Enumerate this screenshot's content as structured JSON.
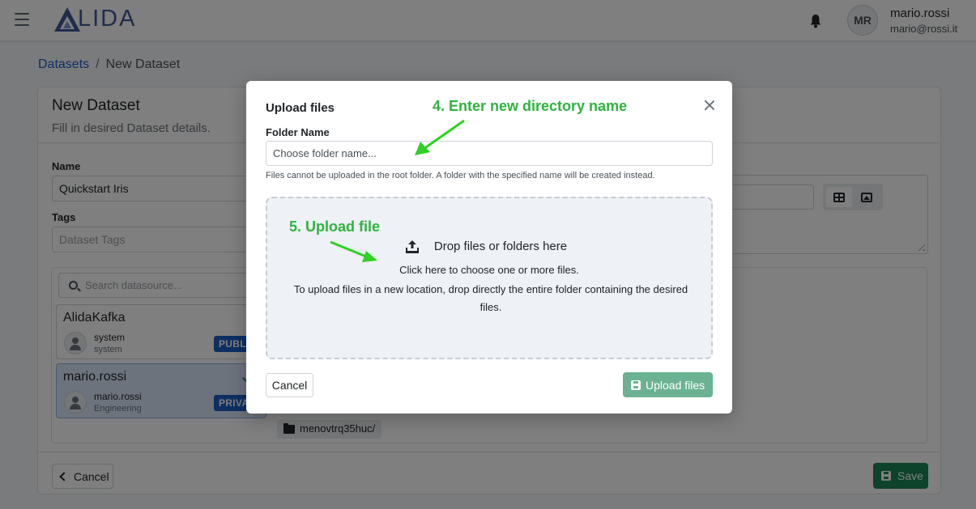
{
  "header": {
    "logo_text": "LIDA",
    "user_initials": "MR",
    "user_name": "mario.rossi",
    "user_email": "mario@rossi.it"
  },
  "breadcrumb": {
    "parent": "Datasets",
    "separator": "/",
    "current": "New Dataset"
  },
  "form": {
    "title": "New Dataset",
    "subtitle": "Fill in desired Dataset details.",
    "name_label": "Name",
    "name_value": "Quickstart Iris",
    "tags_label": "Tags",
    "tags_placeholder": "Dataset Tags",
    "search_placeholder": "Search datasource..."
  },
  "sources": [
    {
      "title": "AlidaKafka",
      "owner": "system",
      "sub": "system",
      "badge": "PUBLI"
    },
    {
      "title": "mario.rossi",
      "owner": "mario.rossi",
      "sub": "Engineering",
      "badge": "PRIVAT"
    }
  ],
  "folder_chip": "menovtrq35huc/",
  "footer": {
    "cancel": "Cancel",
    "save": "Save"
  },
  "modal": {
    "title": "Upload files",
    "folder_label": "Folder Name",
    "folder_placeholder": "Choose folder name...",
    "help": "Files cannot be uploaded in the root folder. A folder with the specified name will be created instead.",
    "dropzone_main": "Drop files or folders here",
    "dropzone_line1": "Click here to choose one or more files.",
    "dropzone_line2": "To upload files in a new location, drop directly the entire folder containing the desired files.",
    "cancel": "Cancel",
    "upload": "Upload files"
  },
  "annotations": {
    "step4": "4. Enter new directory name",
    "step5": "5. Upload file"
  },
  "colors": {
    "primary": "#1a5fc4",
    "success": "#198754",
    "upload_disabled": "#6bb292",
    "annotation": "#2fb33f",
    "backdrop": "rgba(0,0,0,0.5)"
  }
}
